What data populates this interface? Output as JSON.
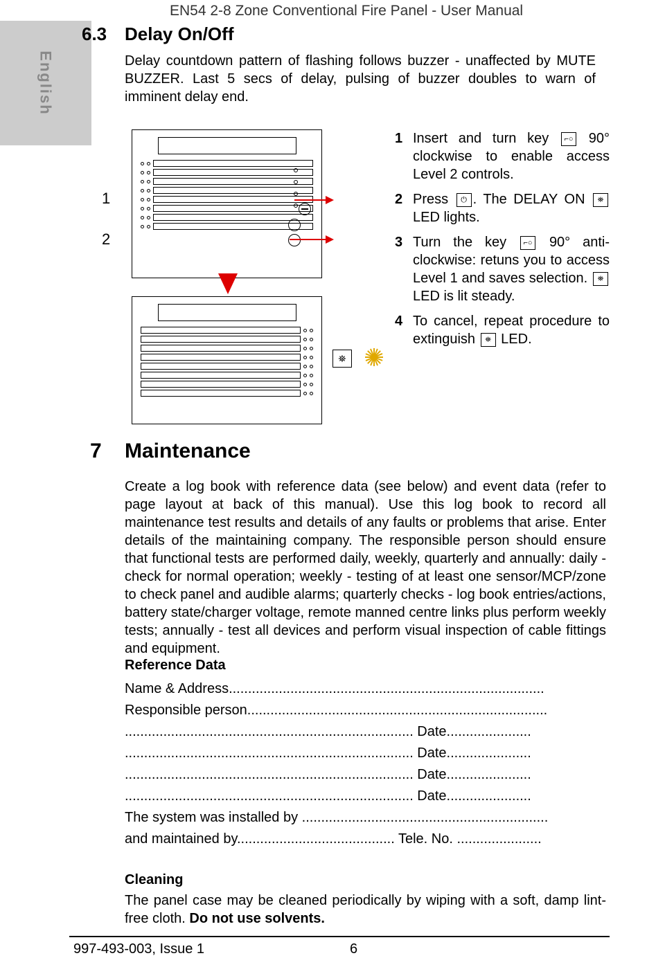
{
  "header": {
    "title": "EN54 2-8 Zone Conventional Fire Panel - User Manual"
  },
  "side_tab": "English",
  "section_63": {
    "num": "6.3",
    "title": "Delay On/Off",
    "intro": "Delay countdown pattern of flashing follows buzzer - unaffected by MUTE BUZZER. Last 5 secs of delay, pulsing of buzzer doubles to warn of imminent delay end."
  },
  "callouts": {
    "c1": "1",
    "c2": "2"
  },
  "steps": {
    "s1n": "1",
    "s1a": "Insert and turn key ",
    "s1b": " 90° clockwise to enable access Level 2 controls.",
    "s2n": "2",
    "s2a": "Press ",
    "s2b": ". The DELAY ON ",
    "s2c": " LED lights.",
    "s3n": "3",
    "s3a": "Turn the key ",
    "s3b": " 90° anti-clockwise: retuns you to access Level 1 and saves selection. ",
    "s3c": " LED is lit steady.",
    "s4n": "4",
    "s4a": "To cancel, repeat procedure to extinguish ",
    "s4b": " LED."
  },
  "icons": {
    "key": "⌐○",
    "clock": "⏻",
    "gear": "⛯"
  },
  "section_7": {
    "num": "7",
    "title": "Maintenance",
    "body": "Create a log book with reference data (see below) and event data (refer to page layout at back of this manual). Use this log book to record all maintenance test results and details of any faults or problems that arise. Enter details of the maintaining company. The responsible person should ensure that functional tests are performed daily, weekly, quarterly and annually: daily - check for normal operation; weekly - testing of at least one sensor/MCP/zone to check panel and audible alarms; quarterly checks - log book entries/actions, battery state/charger voltage, remote manned centre links plus perform weekly tests; annually - test all devices and perform visual inspection of cable fittings and equipment.",
    "refdata_h": "Reference Data",
    "ref": {
      "l1": "Name & Address..................................................................................",
      "l2": "Responsible person..............................................................................",
      "l3": "........................................................................... Date......................",
      "l4": "........................................................................... Date......................",
      "l5": "........................................................................... Date......................",
      "l6": "........................................................................... Date......................",
      "l7": "The system was installed by ................................................................",
      "l8": "and maintained by......................................... Tele. No. ......................"
    },
    "cleaning_h": "Cleaning",
    "cleaning_a": "The panel case may be cleaned periodically by wiping with a soft, damp lint-free cloth. ",
    "cleaning_b": "Do not use solvents."
  },
  "footer": {
    "left": "997-493-003, Issue 1",
    "page": "6"
  }
}
